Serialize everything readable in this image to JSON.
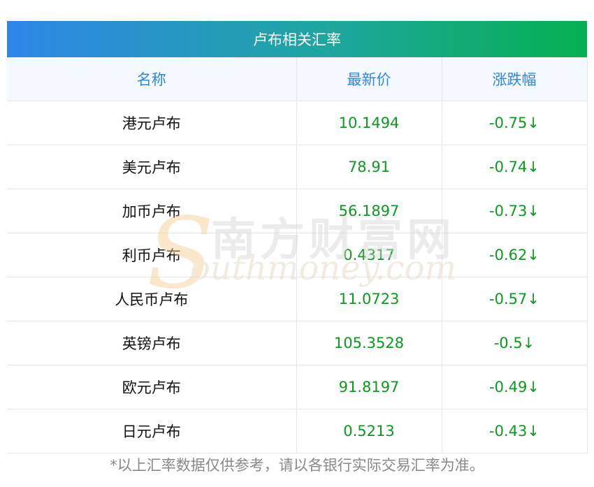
{
  "title": "卢布相关汇率",
  "columns": [
    "名称",
    "最新价",
    "涨跌幅"
  ],
  "rows": [
    {
      "name": "港元卢布",
      "price": "10.1494",
      "change": "-0.75↓"
    },
    {
      "name": "美元卢布",
      "price": "78.91",
      "change": "-0.74↓"
    },
    {
      "name": "加币卢布",
      "price": "56.1897",
      "change": "-0.73↓"
    },
    {
      "name": "利币卢布",
      "price": "0.4317",
      "change": "-0.62↓"
    },
    {
      "name": "人民币卢布",
      "price": "11.0723",
      "change": "-0.57↓"
    },
    {
      "name": "英镑卢布",
      "price": "105.3528",
      "change": "-0.5↓"
    },
    {
      "name": "欧元卢布",
      "price": "91.8197",
      "change": "-0.49↓"
    },
    {
      "name": "日元卢布",
      "price": "0.5213",
      "change": "-0.43↓"
    }
  ],
  "watermark": {
    "cn": "南方财富网",
    "en": "outhmoney.com",
    "s": "S"
  },
  "footer": "*以上汇率数据仅供参考，请以各银行实际交易汇率为准。",
  "colors": {
    "header_gradient_start": "#2f86e8",
    "header_gradient_end": "#06b050",
    "column_header_text": "#2f86e8",
    "value_text": "#0a9a1e"
  }
}
